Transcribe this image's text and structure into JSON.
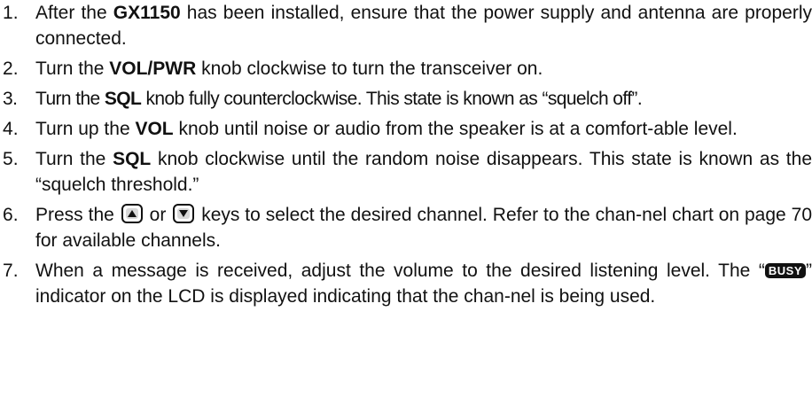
{
  "steps": [
    {
      "num": "1",
      "text_a": "After the ",
      "bold": "GX1150",
      "text_b": " has been installed, ensure that the power supply and antenna are properly connected."
    },
    {
      "num": "2",
      "text_a": "Turn the ",
      "bold": "VOL/PWR",
      "text_b": " knob clockwise to turn the transceiver on."
    },
    {
      "num": "3",
      "text_a": "Turn the ",
      "bold": "SQL",
      "text_b": " knob fully counterclockwise. This state is known as “squelch off”."
    },
    {
      "num": "4",
      "text_a": "Turn up the ",
      "bold": "VOL",
      "text_b": " knob until noise or audio from the speaker is at a comfort-able level."
    },
    {
      "num": "5",
      "text_a": "Turn the ",
      "bold": "SQL",
      "text_b": " knob clockwise until the random noise disappears. This state is known as the “squelch threshold.”"
    },
    {
      "num": "6",
      "text_a": "Press the ",
      "key_up_icon": "up-arrow-key-icon",
      "text_mid": " or ",
      "key_down_icon": "down-arrow-key-icon",
      "text_b": " keys to select the desired channel. Refer to the chan-nel chart on page 70 for available channels."
    },
    {
      "num": "7",
      "text_a": "When a message is received, adjust the volume to the desired listening level. The “",
      "badge": "BUSY",
      "text_b": "” indicator on the LCD is displayed indicating that the chan-nel is being used."
    }
  ]
}
